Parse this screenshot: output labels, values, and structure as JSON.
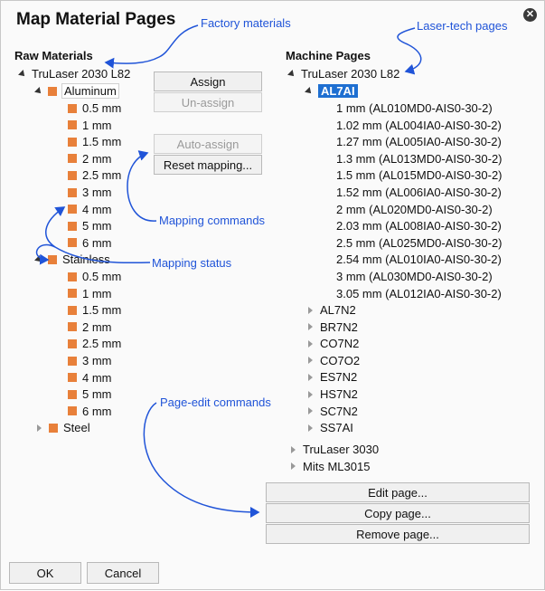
{
  "dialog": {
    "title": "Map Material Pages",
    "close_glyph": "✕"
  },
  "annotations": {
    "factory": "Factory materials",
    "lasertech": "Laser-tech pages",
    "mapping_commands": "Mapping commands",
    "mapping_status": "Mapping status",
    "page_edit": "Page-edit commands"
  },
  "raw": {
    "heading": "Raw Materials",
    "root": "TruLaser 2030 L82",
    "aluminum": {
      "label": "Aluminum",
      "items": [
        "0.5 mm",
        "1 mm",
        "1.5 mm",
        "2 mm",
        "2.5 mm",
        "3 mm",
        "4 mm",
        "5 mm",
        "6 mm"
      ]
    },
    "stainless": {
      "label": "Stainless",
      "items": [
        "0.5 mm",
        "1 mm",
        "1.5 mm",
        "2 mm",
        "2.5 mm",
        "3 mm",
        "4 mm",
        "5 mm",
        "6 mm"
      ]
    },
    "steel": "Steel"
  },
  "mapping": {
    "assign": "Assign",
    "unassign": "Un-assign",
    "auto_assign": "Auto-assign",
    "reset": "Reset mapping..."
  },
  "machine": {
    "heading": "Machine Pages",
    "root": "TruLaser 2030 L82",
    "group": "AL7AI",
    "pages": [
      "1 mm (AL010MD0-AIS0-30-2)",
      "1.02 mm (AL004IA0-AIS0-30-2)",
      "1.27 mm (AL005IA0-AIS0-30-2)",
      "1.3 mm (AL013MD0-AIS0-30-2)",
      "1.5 mm (AL015MD0-AIS0-30-2)",
      "1.52 mm (AL006IA0-AIS0-30-2)",
      "2 mm (AL020MD0-AIS0-30-2)",
      "2.03 mm (AL008IA0-AIS0-30-2)",
      "2.5 mm (AL025MD0-AIS0-30-2)",
      "2.54 mm (AL010IA0-AIS0-30-2)",
      "3 mm (AL030MD0-AIS0-30-2)",
      "3.05 mm (AL012IA0-AIS0-30-2)"
    ],
    "groups": [
      "AL7N2",
      "BR7N2",
      "CO7N2",
      "CO7O2",
      "ES7N2",
      "HS7N2",
      "SC7N2",
      "SS7AI"
    ],
    "others": [
      "TruLaser 3030",
      "Mits ML3015"
    ]
  },
  "page_edit": {
    "edit": "Edit page...",
    "copy": "Copy page...",
    "remove": "Remove page..."
  },
  "footer": {
    "ok": "OK",
    "cancel": "Cancel"
  },
  "colors": {
    "accent": "#1e6fd1",
    "annotation": "#2054d8",
    "material_square": "#e8803a"
  },
  "icons": {
    "close": "close-icon",
    "expanded": "expanded-triangle-icon",
    "collapsed": "collapsed-triangle-icon",
    "material": "material-square-icon"
  }
}
